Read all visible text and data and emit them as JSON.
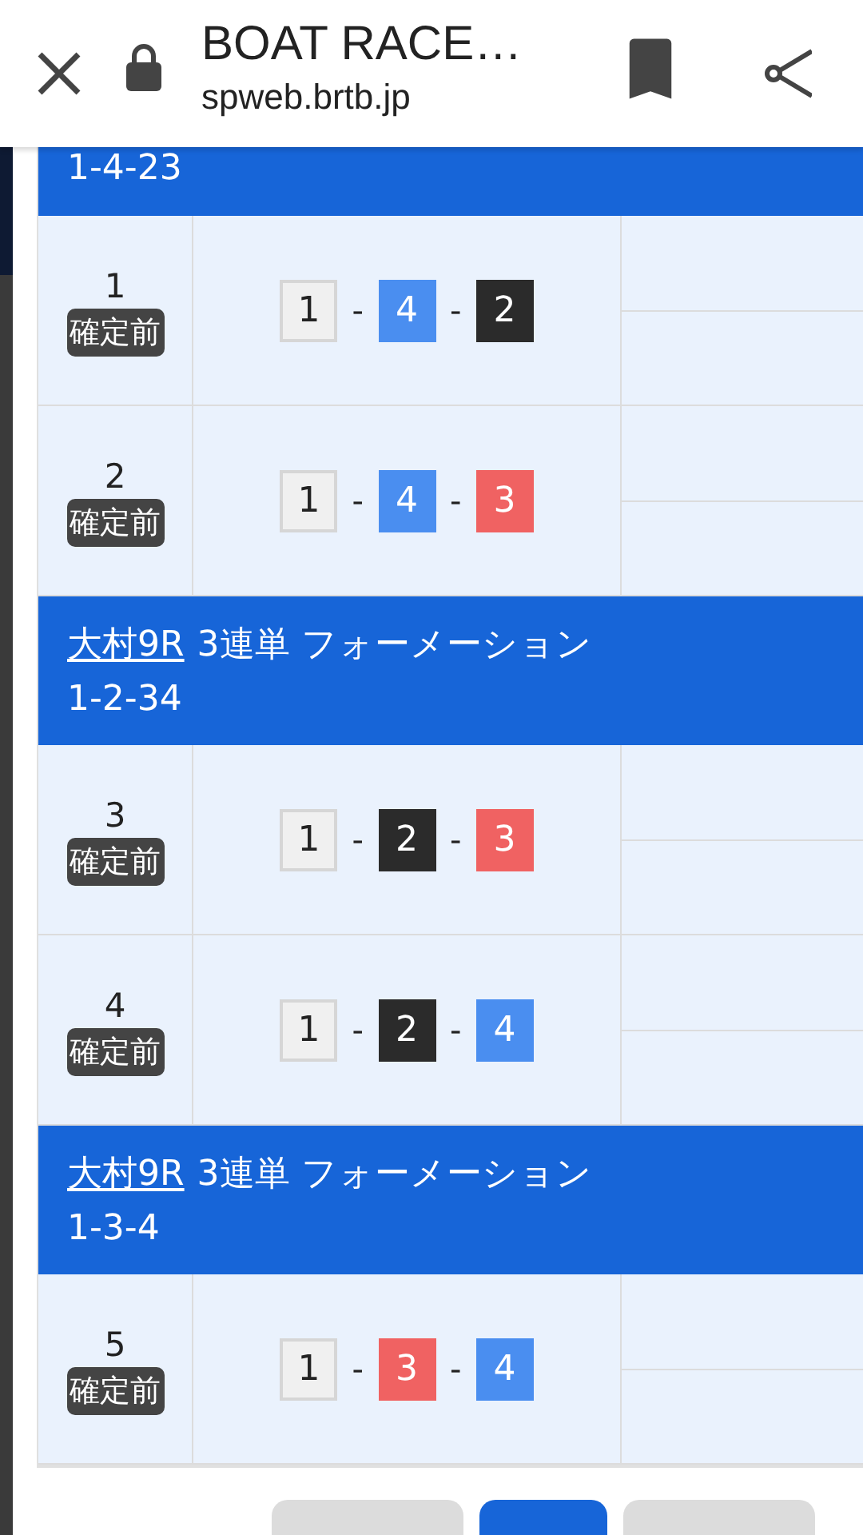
{
  "browser_bar": {
    "title": "BOAT RACE…",
    "url": "spweb.brtb.jp"
  },
  "sections": [
    {
      "combination": "1-4-23",
      "rows": [
        {
          "number": "1",
          "status": "確定前",
          "separator": "-",
          "boats": [
            {
              "number": "1",
              "color": "#f0f0f0"
            },
            {
              "number": "4",
              "color": "#4a8ef0"
            },
            {
              "number": "2",
              "color": "#2b2b2b"
            }
          ]
        },
        {
          "number": "2",
          "status": "確定前",
          "separator": "-",
          "boats": [
            {
              "number": "1",
              "color": "#f0f0f0"
            },
            {
              "number": "4",
              "color": "#4a8ef0"
            },
            {
              "number": "3",
              "color": "#f06262"
            }
          ]
        }
      ]
    },
    {
      "venue_link": "大村9R",
      "bet_type": "3連単 フォーメーション",
      "combination": "1-2-34",
      "rows": [
        {
          "number": "3",
          "status": "確定前",
          "separator": "-",
          "boats": [
            {
              "number": "1",
              "color": "#f0f0f0"
            },
            {
              "number": "2",
              "color": "#2b2b2b"
            },
            {
              "number": "3",
              "color": "#f06262"
            }
          ]
        },
        {
          "number": "4",
          "status": "確定前",
          "separator": "-",
          "boats": [
            {
              "number": "1",
              "color": "#f0f0f0"
            },
            {
              "number": "2",
              "color": "#2b2b2b"
            },
            {
              "number": "4",
              "color": "#4a8ef0"
            }
          ]
        }
      ]
    },
    {
      "venue_link": "大村9R",
      "bet_type": "3連単 フォーメーション",
      "combination": "1-3-4",
      "rows": [
        {
          "number": "5",
          "status": "確定前",
          "separator": "-",
          "boats": [
            {
              "number": "1",
              "color": "#f0f0f0"
            },
            {
              "number": "3",
              "color": "#f06262"
            },
            {
              "number": "4",
              "color": "#4a8ef0"
            }
          ]
        }
      ]
    }
  ],
  "bottom_buttons": [
    {
      "selected": false
    },
    {
      "selected": true
    },
    {
      "selected": false
    }
  ]
}
